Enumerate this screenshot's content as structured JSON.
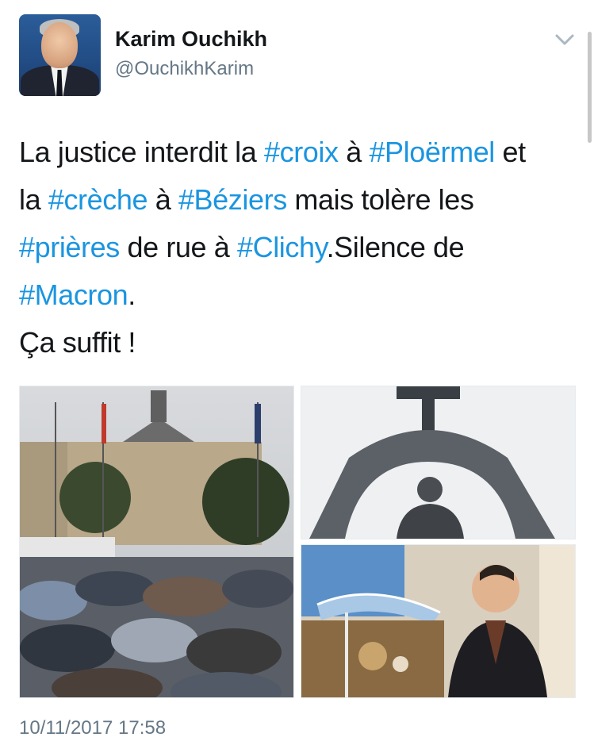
{
  "author": {
    "name": "Karim Ouchikh",
    "handle": "@OuchikhKarim",
    "avatar_icon": "profile-photo"
  },
  "menu": {
    "icon": "chevron-down-icon"
  },
  "tweet": {
    "lines": [
      [
        {
          "text": "La justice interdit la ",
          "hashtag": false
        },
        {
          "text": "#croix",
          "hashtag": true
        },
        {
          "text": " à ",
          "hashtag": false
        },
        {
          "text": "#Ploërmel",
          "hashtag": true
        },
        {
          "text": " et",
          "hashtag": false
        }
      ],
      [
        {
          "text": "la ",
          "hashtag": false
        },
        {
          "text": "#crèche",
          "hashtag": true
        },
        {
          "text": " à ",
          "hashtag": false
        },
        {
          "text": "#Béziers",
          "hashtag": true
        },
        {
          "text": " mais tolère les",
          "hashtag": false
        }
      ],
      [
        {
          "text": "#prières",
          "hashtag": true
        },
        {
          "text": " de rue à ",
          "hashtag": false
        },
        {
          "text": "#Clichy",
          "hashtag": true
        },
        {
          "text": ".Silence de",
          "hashtag": false
        }
      ],
      [
        {
          "text": "#Macron",
          "hashtag": true
        },
        {
          "text": ".",
          "hashtag": false
        }
      ],
      [
        {
          "text": "Ça suffit !",
          "hashtag": false
        }
      ]
    ],
    "hashtag_color": "#1b95e0"
  },
  "media": {
    "images": [
      "street-prayers-photo",
      "ploermel-cross-statue-photo",
      "beziers-nativity-photo"
    ]
  },
  "timestamp": "10/11/2017 17:58"
}
